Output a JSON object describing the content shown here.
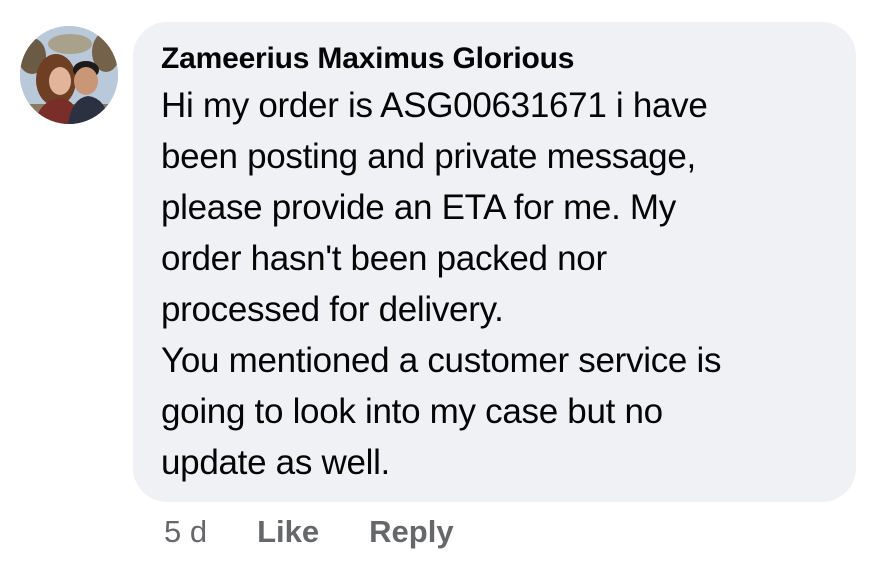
{
  "comment": {
    "author": "Zameerius Maximus Glorious",
    "text_lines": [
      "Hi my order is ASG00631671 i have",
      "been posting and private message,",
      "please provide an ETA for me. My",
      "order hasn't been packed nor",
      "processed for delivery.",
      "You mentioned a customer service is",
      "going to look into my case but no",
      "update as well."
    ],
    "timestamp": "5 d",
    "actions": {
      "like_label": "Like",
      "reply_label": "Reply"
    }
  },
  "colors": {
    "bubble_background": "#eff1f5",
    "text": "#050505",
    "secondary_text": "#65676b"
  },
  "icons": {
    "avatar": "profile-photo-avatar"
  }
}
